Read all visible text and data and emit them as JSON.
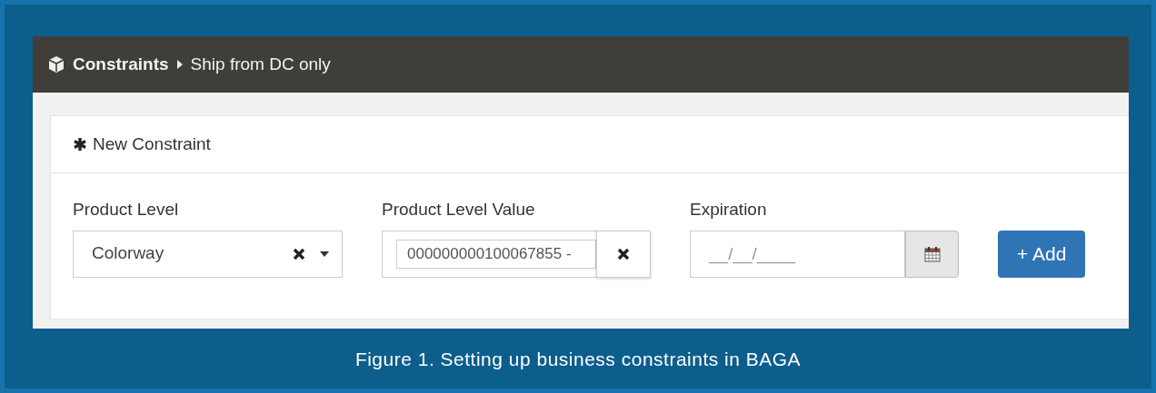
{
  "breadcrumb": {
    "section": "Constraints",
    "current": "Ship from DC only"
  },
  "panel": {
    "title": "New Constraint"
  },
  "fields": [
    {
      "kind": "select",
      "label": "Product Level",
      "value": "Colorway"
    },
    {
      "kind": "tag",
      "label": "Product Level Value",
      "value": "000000000100067855 -"
    },
    {
      "kind": "date",
      "label": "Expiration",
      "placeholder": "__/__/____"
    }
  ],
  "add_button": "+ Add",
  "caption": "Figure 1. Setting up business constraints in BAGA"
}
